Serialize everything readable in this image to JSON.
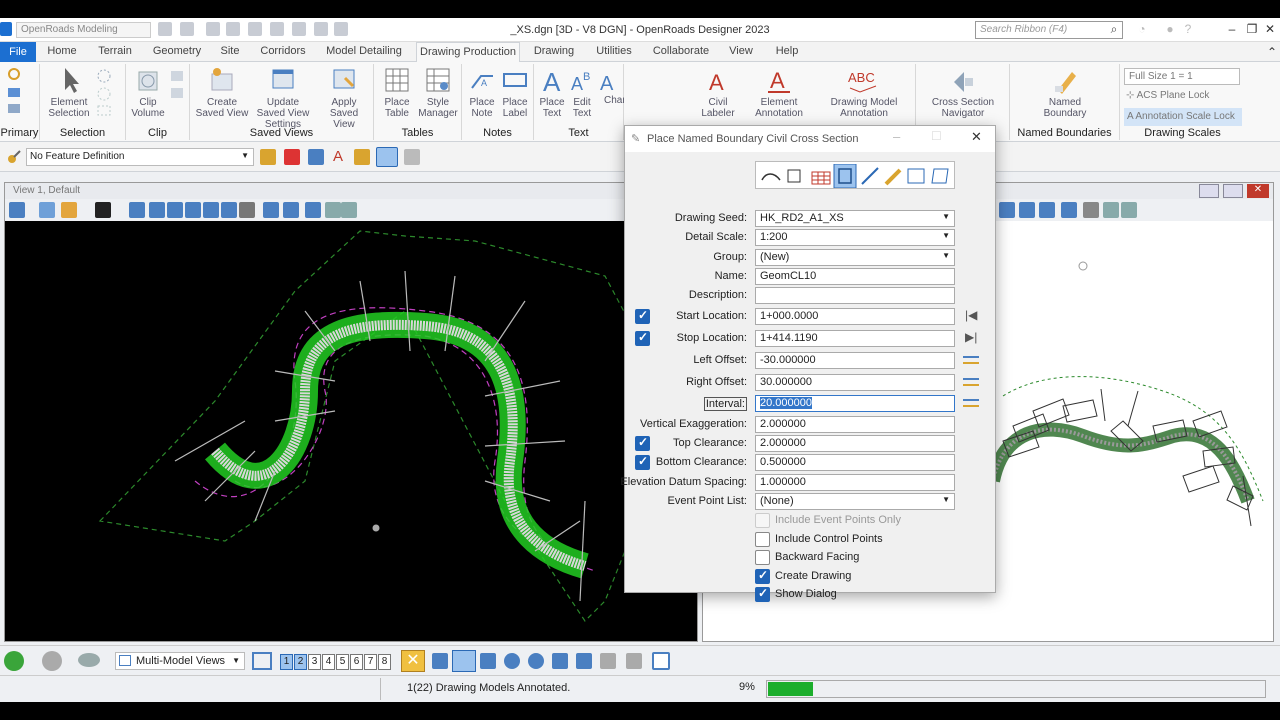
{
  "titlebar": {
    "workspace": "OpenRoads Modeling",
    "title": "_XS.dgn [3D - V8 DGN] - OpenRoads Designer 2023",
    "search_placeholder": "Search Ribbon (F4)"
  },
  "tabs": [
    "File",
    "Home",
    "Terrain",
    "Geometry",
    "Site",
    "Corridors",
    "Model Detailing",
    "Drawing Production",
    "Drawing",
    "Utilities",
    "Collaborate",
    "View",
    "Help"
  ],
  "active_tab": "Drawing Production",
  "ribbon": {
    "groups": [
      "Primary",
      "Selection",
      "Clip",
      "Saved Views",
      "Tables",
      "Notes",
      "Text",
      "",
      "Named Boundaries",
      "Drawing Scales"
    ],
    "buttons": {
      "element_selection": "Element Selection",
      "clip_volume": "Clip Volume",
      "create_saved_view": "Create Saved View",
      "update_saved_view": "Update Saved View Settings",
      "apply_saved_view": "Apply Saved View",
      "place_table": "Place Table",
      "style_manager": "Style Manager",
      "place_note": "Place Note",
      "place_label": "Place Label",
      "place_text": "Place Text",
      "edit_text": "Edit Text",
      "change_text_attributes": "Change Text Attributes",
      "civil_labeler": "Civil Labeler",
      "element_annotation": "Element Annotation",
      "drawing_model_annotation": "Drawing Model Annotation",
      "section_navigator": "Cross Section Navigator",
      "named_boundary": "Named Boundary"
    },
    "scales": {
      "full_size": "Full Size 1 = 1",
      "acs_plane_lock": "ACS Plane Lock",
      "annotation_scale_lock": "Annotation Scale Lock"
    }
  },
  "feature_definition": "No Feature Definition",
  "view1": {
    "title": "View 1, Default"
  },
  "dialog": {
    "title": "Place Named Boundary Civil Cross Section",
    "fields": {
      "drawing_seed": {
        "label": "Drawing Seed:",
        "value": "HK_RD2_A1_XS"
      },
      "detail_scale": {
        "label": "Detail Scale:",
        "value": "1:200"
      },
      "group": {
        "label": "Group:",
        "value": "(New)"
      },
      "name": {
        "label": "Name:",
        "value": "GeomCL10"
      },
      "description": {
        "label": "Description:",
        "value": ""
      },
      "start_location": {
        "label": "Start Location:",
        "value": "1+000.0000"
      },
      "stop_location": {
        "label": "Stop Location:",
        "value": "1+414.1190"
      },
      "left_offset": {
        "label": "Left Offset:",
        "value": "-30.000000"
      },
      "right_offset": {
        "label": "Right Offset:",
        "value": "30.000000"
      },
      "interval": {
        "label": "Interval:",
        "value": "20.000000"
      },
      "vertical_exaggeration": {
        "label": "Vertical Exaggeration:",
        "value": "2.000000"
      },
      "top_clearance": {
        "label": "Top Clearance:",
        "value": "2.000000"
      },
      "bottom_clearance": {
        "label": "Bottom Clearance:",
        "value": "0.500000"
      },
      "elevation_datum_spacing": {
        "label": "Elevation Datum Spacing:",
        "value": "1.000000"
      },
      "event_point_list": {
        "label": "Event Point List:",
        "value": "(None)"
      }
    },
    "options": {
      "include_event_points_only": "Include Event Points Only",
      "include_control_points": "Include Control Points",
      "backward_facing": "Backward Facing",
      "create_drawing": "Create Drawing",
      "show_dialog": "Show Dialog"
    }
  },
  "bottom": {
    "model_views": "Multi-Model Views",
    "view_numbers": [
      "1",
      "2",
      "3",
      "4",
      "5",
      "6",
      "7",
      "8"
    ]
  },
  "status": {
    "message": "1(22) Drawing Models Annotated.",
    "progress_label": "9%",
    "progress": 0.09
  },
  "colors": {
    "accent": "#1f63b6",
    "alignment_green": "#22cc22",
    "progress_green": "#1cae2c"
  }
}
